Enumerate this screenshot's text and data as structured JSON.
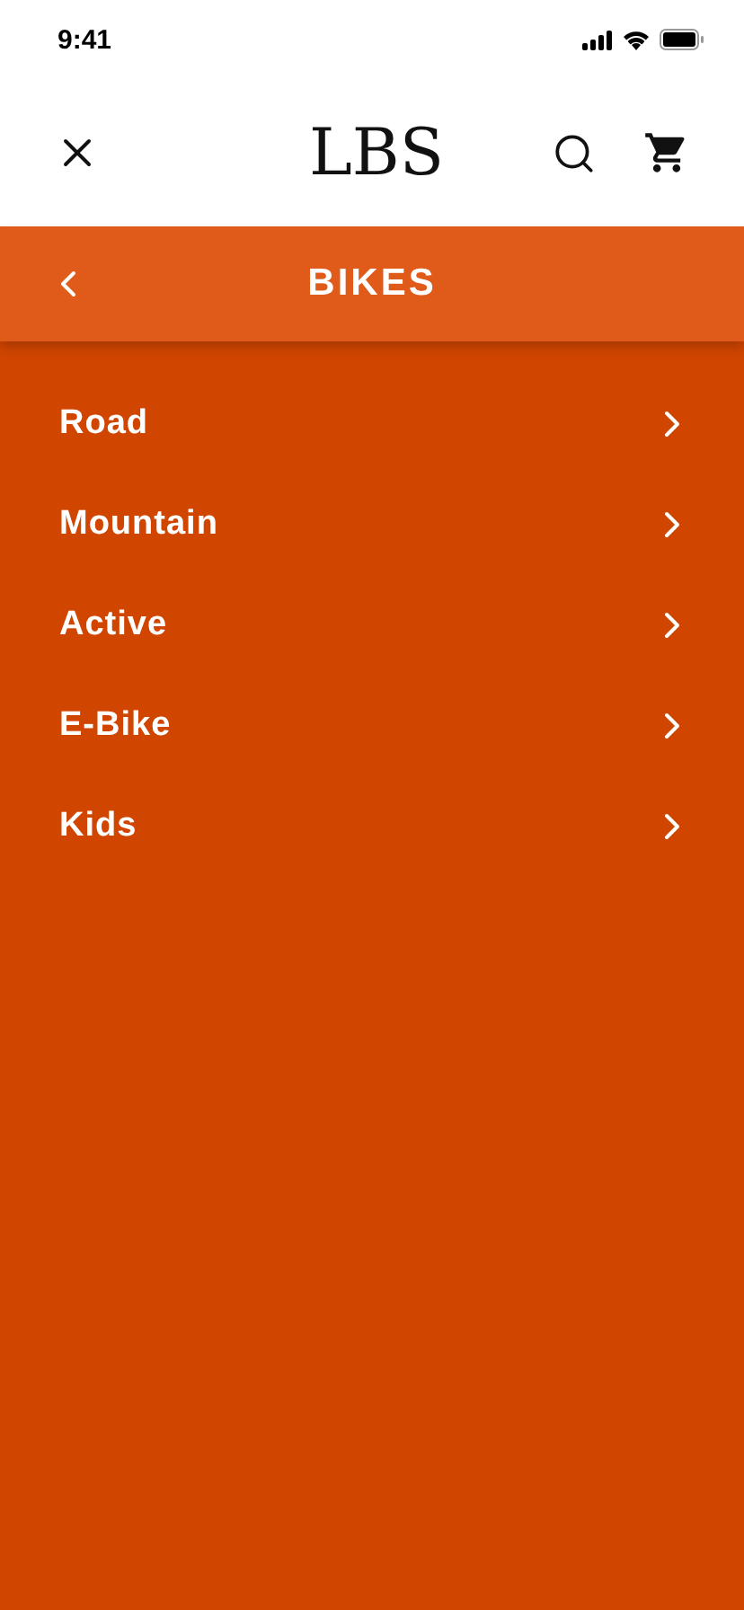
{
  "status_bar": {
    "time": "9:41"
  },
  "header": {
    "logo": "LBS"
  },
  "section": {
    "title": "BIKES"
  },
  "menu": [
    {
      "label": "Road"
    },
    {
      "label": "Mountain"
    },
    {
      "label": "Active"
    },
    {
      "label": "E-Bike"
    },
    {
      "label": "Kids"
    }
  ]
}
